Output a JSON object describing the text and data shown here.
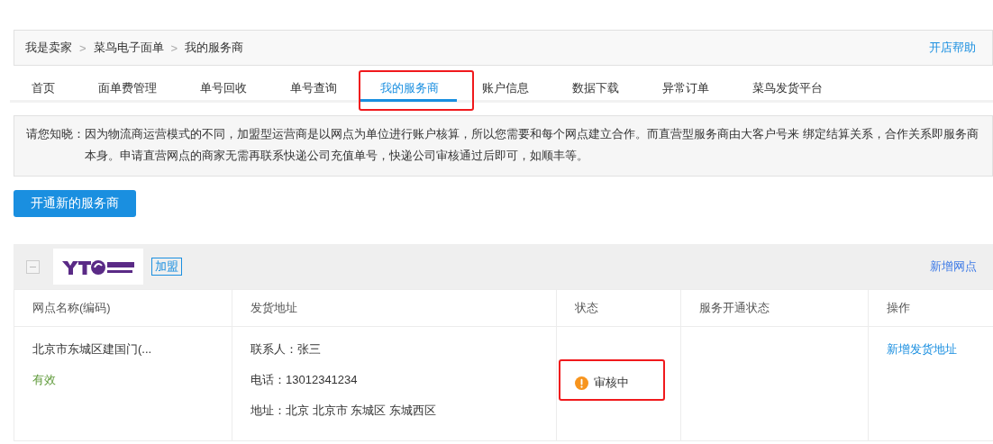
{
  "breadcrumb": [
    "我是卖家",
    "菜鸟电子面单",
    "我的服务商"
  ],
  "breadcrumb_separator": ">",
  "help_link": "开店帮助",
  "tabs": [
    {
      "label": "首页",
      "selected": false,
      "highlighted": false
    },
    {
      "label": "面单费管理",
      "selected": false,
      "highlighted": false
    },
    {
      "label": "单号回收",
      "selected": false,
      "highlighted": false
    },
    {
      "label": "单号查询",
      "selected": false,
      "highlighted": false
    },
    {
      "label": "我的服务商",
      "selected": true,
      "highlighted": true
    },
    {
      "label": "账户信息",
      "selected": false,
      "highlighted": false
    },
    {
      "label": "数据下载",
      "selected": false,
      "highlighted": false
    },
    {
      "label": "异常订单",
      "selected": false,
      "highlighted": false
    },
    {
      "label": "菜鸟发货平台",
      "selected": false,
      "highlighted": false
    }
  ],
  "notice": {
    "label": "请您知晓：",
    "text": "因为物流商运营模式的不同，加盟型运营商是以网点为单位进行账户核算，所以您需要和每个网点建立合作。而直营型服务商由大客户号来 绑定结算关系，合作关系即服务商本身。申请直营网点的商家无需再联系快递公司充值单号，快递公司审核通过后即可，如顺丰等。"
  },
  "primary_button": "开通新的服务商",
  "provider": {
    "expanded": true,
    "type_tag": "加盟",
    "add_link": "新增网点",
    "table": {
      "columns": [
        "网点名称(编码)",
        "发货地址",
        "状态",
        "服务开通状态",
        "操作"
      ],
      "rows": [
        {
          "name": "北京市东城区建国门(...",
          "validity": "有效",
          "address_lines": [
            "联系人：张三",
            "电话：13012341234",
            "地址：北京 北京市 东城区 东城西区"
          ],
          "status": {
            "text": "审核中",
            "kind": "warning",
            "highlighted": true
          },
          "action": "新增发货地址"
        }
      ]
    }
  }
}
